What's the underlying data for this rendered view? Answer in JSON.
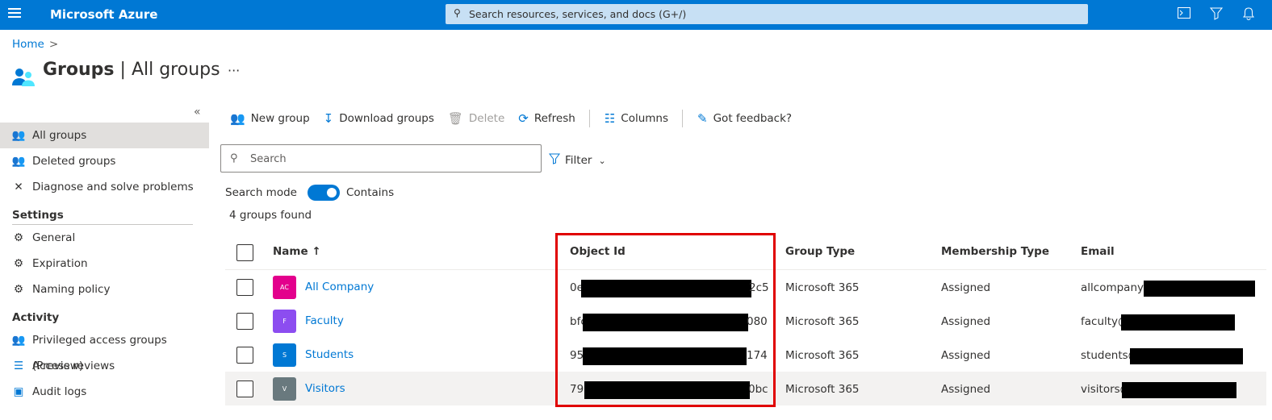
{
  "topbar": {
    "brand": "Microsoft Azure",
    "search_placeholder": "Search resources, services, and docs (G+/)"
  },
  "breadcrumb": {
    "home": "Home",
    "separator": ">"
  },
  "header": {
    "title_main": "Groups",
    "title_sep": " | ",
    "title_sub": "All groups",
    "more": "···"
  },
  "sidebar": {
    "collapse": "«",
    "items_top": [
      {
        "label": "All groups",
        "icon": "groups-icon",
        "active": true
      },
      {
        "label": "Deleted groups",
        "icon": "groups-icon"
      },
      {
        "label": "Diagnose and solve problems",
        "icon": "wrench-icon"
      }
    ],
    "settings_title": "Settings",
    "settings_items": [
      {
        "label": "General",
        "icon": "gear-icon"
      },
      {
        "label": "Expiration",
        "icon": "gear-icon"
      },
      {
        "label": "Naming policy",
        "icon": "gear-icon"
      }
    ],
    "activity_title": "Activity",
    "activity_items": [
      {
        "label": "Privileged access groups (Preview)",
        "icon": "groups-icon"
      },
      {
        "label": "Access reviews",
        "icon": "list-check-icon"
      },
      {
        "label": "Audit logs",
        "icon": "log-icon"
      }
    ]
  },
  "toolbar": {
    "new_group": "New group",
    "download_groups": "Download groups",
    "delete": "Delete",
    "refresh": "Refresh",
    "columns": "Columns",
    "feedback": "Got feedback?"
  },
  "search": {
    "placeholder": "Search"
  },
  "filter": {
    "label": "Filter"
  },
  "search_mode": {
    "label": "Search mode",
    "value": "Contains"
  },
  "count_text": "4 groups found",
  "table": {
    "headers": {
      "name": "Name ↑",
      "object_id": "Object Id",
      "group_type": "Group Type",
      "membership_type": "Membership Type",
      "email": "Email"
    },
    "rows": [
      {
        "initials": "AC",
        "color": "#e3008c",
        "name": "All Company",
        "id_prefix": "0e",
        "id_suffix": "2c5",
        "group_type": "Microsoft 365",
        "membership": "Assigned",
        "email_prefix": "allcompany@"
      },
      {
        "initials": "F",
        "color": "#8c4df0",
        "name": "Faculty",
        "id_prefix": "bfc",
        "id_suffix": "080",
        "group_type": "Microsoft 365",
        "membership": "Assigned",
        "email_prefix": "faculty@"
      },
      {
        "initials": "S",
        "color": "#0078d4",
        "name": "Students",
        "id_prefix": "95b",
        "id_suffix": "174",
        "group_type": "Microsoft 365",
        "membership": "Assigned",
        "email_prefix": "students@"
      },
      {
        "initials": "V",
        "color": "#69797e",
        "name": "Visitors",
        "id_prefix": "79b",
        "id_suffix": "0bc",
        "group_type": "Microsoft 365",
        "membership": "Assigned",
        "email_prefix": "visitors@"
      }
    ]
  },
  "colors": {
    "accent": "#0078d4",
    "highlight": "#e00000"
  }
}
